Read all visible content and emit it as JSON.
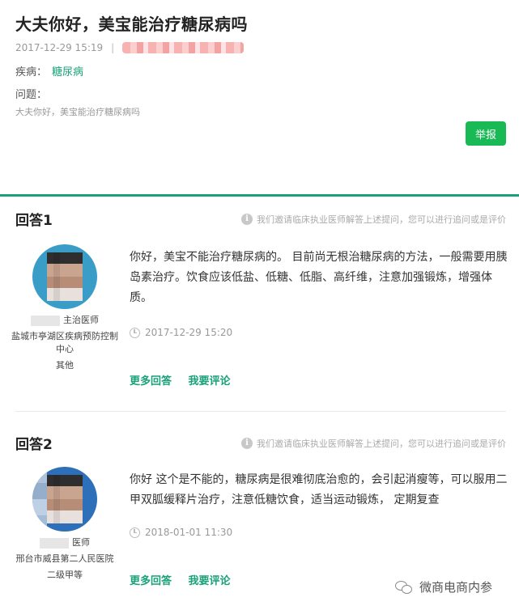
{
  "question": {
    "title": "大夫你好，美宝能治疗糖尿病吗",
    "date": "2017-12-29 15:19",
    "separator": "|",
    "disease_label": "疾病：",
    "disease_value": "糖尿病",
    "problem_label": "问题：",
    "problem_text": "大夫你好，美宝能治疗糖尿病吗",
    "report_label": "举报"
  },
  "answers": [
    {
      "heading": "回答1",
      "tip": "我们邀请临床执业医师解答上述提问，您可以进行追问或是评价",
      "doctor_title": "主治医师",
      "doctor_org": "盐城市亭湖区疾病预防控制中心",
      "doctor_level": "其他",
      "body": "你好，美宝不能治疗糖尿病的。 目前尚无根治糖尿病的方法，一般需要用胰岛素治疗。饮食应该低盐、低糖、低脂、高纤维，注意加强锻炼，增强体质。",
      "time": "2017-12-29 15:20",
      "more_label": "更多回答",
      "comment_label": "我要评论"
    },
    {
      "heading": "回答2",
      "tip": "我们邀请临床执业医师解答上述提问，您可以进行追问或是评价",
      "doctor_title": "医师",
      "doctor_org": "邢台市威县第二人民医院",
      "doctor_level": "二级甲等",
      "body": "你好 这个是不能的，糖尿病是很难彻底治愈的，会引起消瘦等，可以服用二甲双胍缓释片治疗，注意低糖饮食，适当运动锻炼， 定期复查",
      "time": "2018-01-01 11:30",
      "more_label": "更多回答",
      "comment_label": "我要评论"
    }
  ],
  "watermark": "微商电商内参",
  "icons": {
    "info": "info-icon",
    "clock": "clock-icon",
    "wechat": "wechat-icon"
  },
  "colors": {
    "accent": "#1aa179",
    "report_button": "#19b955"
  }
}
